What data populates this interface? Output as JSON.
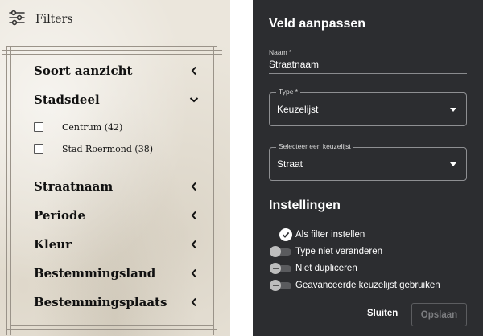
{
  "filters_panel": {
    "header": {
      "icon": "sliders-icon",
      "label": "Filters"
    },
    "categories": [
      {
        "label": "Soort aanzicht",
        "state": "collapsed",
        "chevron": "chevron-left-icon"
      },
      {
        "label": "Stadsdeel",
        "state": "expanded",
        "chevron": "chevron-down-icon",
        "options": [
          {
            "label": "Centrum (42)",
            "checked": false
          },
          {
            "label": "Stad Roermond (38)",
            "checked": false
          }
        ]
      },
      {
        "label": "Straatnaam",
        "state": "collapsed",
        "chevron": "chevron-left-icon"
      },
      {
        "label": "Periode",
        "state": "collapsed",
        "chevron": "chevron-left-icon"
      },
      {
        "label": "Kleur",
        "state": "collapsed",
        "chevron": "chevron-left-icon"
      },
      {
        "label": "Bestemmingsland",
        "state": "collapsed",
        "chevron": "chevron-left-icon"
      },
      {
        "label": "Bestemmingsplaats",
        "state": "collapsed",
        "chevron": "chevron-left-icon"
      }
    ]
  },
  "dialog": {
    "title": "Veld aanpassen",
    "name_field": {
      "label": "Naam *",
      "value": "Straatnaam"
    },
    "type_select": {
      "label": "Type *",
      "value": "Keuzelijst"
    },
    "list_select": {
      "label": "Selecteer een keuzelijst",
      "value": "Straat"
    },
    "settings_title": "Instellingen",
    "settings": [
      {
        "label": "Als filter instellen",
        "control": "checkbox",
        "on": true
      },
      {
        "label": "Type niet veranderen",
        "control": "toggle",
        "on": false
      },
      {
        "label": "Niet dupliceren",
        "control": "toggle",
        "on": false
      },
      {
        "label": "Geavanceerde keuzelijst gebruiken",
        "control": "toggle",
        "on": false
      }
    ],
    "close_button": "Sluiten",
    "save_button": {
      "label": "Opslaan",
      "enabled": false
    }
  },
  "colors": {
    "dialog_background": "#2c2d30",
    "panel_background": "#ebe6dc",
    "frame_line": "#9a9389",
    "disabled_text": "#7c7d80"
  }
}
